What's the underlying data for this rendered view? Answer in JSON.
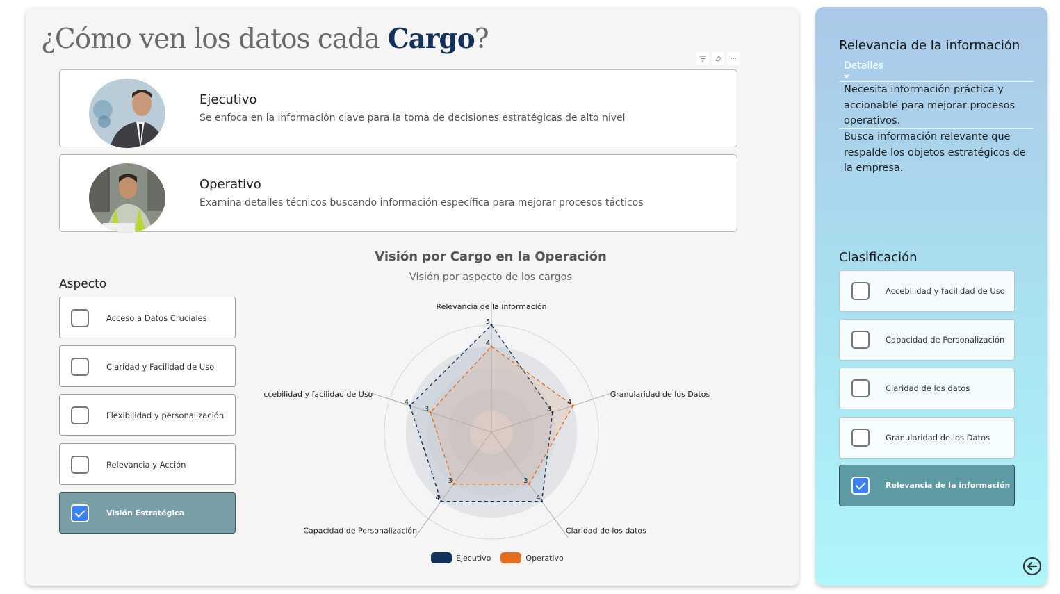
{
  "header": {
    "title_prefix": "¿Cómo ven los datos cada",
    "title_accent": "Cargo",
    "title_suffix": "?"
  },
  "visual_tools": {
    "filter": "filter-icon",
    "eraser": "eraser-icon",
    "more": "more-options-icon"
  },
  "roles": [
    {
      "name": "Ejecutivo",
      "description": "Se enfoca en la información clave para la toma de decisiones estratégicas de alto nivel"
    },
    {
      "name": "Operativo",
      "description": "Examina detalles técnicos buscando información específica para mejorar procesos tácticos"
    }
  ],
  "aspect": {
    "title": "Aspecto",
    "items": [
      {
        "label": "Acceso a Datos Cruciales",
        "selected": false
      },
      {
        "label": "Claridad y Facilidad de Uso",
        "selected": false
      },
      {
        "label": "Flexibilidad y personalización",
        "selected": false
      },
      {
        "label": "Relevancia y Acción",
        "selected": false
      },
      {
        "label": "Visión Estratégica",
        "selected": true
      }
    ]
  },
  "chart_data": {
    "type": "radar",
    "title": "Visión por Cargo en la Operación",
    "subtitle": "Visión por aspecto de los cargos",
    "axes": [
      "Relevancia de la información",
      "Granularidad de los Datos",
      "Claridad de los datos",
      "Capacidad de Personalización",
      "Accebilidad y facilidad de Uso"
    ],
    "range": [
      0,
      5
    ],
    "series": [
      {
        "name": "Ejecutivo",
        "values": [
          5,
          3,
          4,
          4,
          4
        ],
        "color": "#13315c"
      },
      {
        "name": "Operativo",
        "values": [
          4,
          4,
          3,
          3,
          3
        ],
        "color": "#e66c1e"
      }
    ],
    "legend_position": "bottom"
  },
  "right_panel": {
    "title": "Relevancia de la información",
    "details_label": "Detalles",
    "texts": [
      "Necesita información práctica y accionable para mejorar procesos operativos.",
      "Busca información relevante que respalde los objetos estratégicos de la empresa."
    ],
    "classification_title": "Clasificación",
    "classification_items": [
      {
        "label": "Accebilidad y facilidad de Uso",
        "selected": false
      },
      {
        "label": "Capacidad de Personalización",
        "selected": false
      },
      {
        "label": "Claridad de los datos",
        "selected": false
      },
      {
        "label": "Granularidad de los Datos",
        "selected": false
      },
      {
        "label": "Relevancia de la información",
        "selected": true
      }
    ],
    "back_icon": "back-arrow-icon"
  }
}
